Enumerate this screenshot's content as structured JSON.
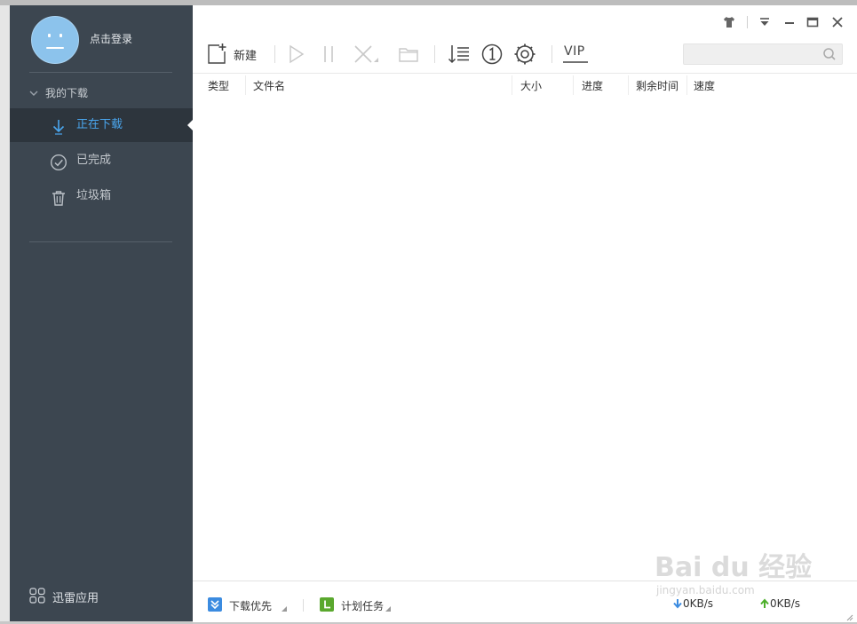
{
  "sidebar": {
    "login_label": "点击登录",
    "group_label": "我的下载",
    "items": [
      {
        "label": "正在下载",
        "icon": "download-arrow-icon",
        "active": true
      },
      {
        "label": "已完成",
        "icon": "check-circle-icon",
        "active": false
      },
      {
        "label": "垃圾箱",
        "icon": "trash-icon",
        "active": false
      }
    ],
    "apps_label": "迅雷应用"
  },
  "toolbar": {
    "new_label": "新建",
    "vip_label": "VIP",
    "search_placeholder": ""
  },
  "table": {
    "columns": [
      "类型",
      "文件名",
      "大小",
      "进度",
      "剩余时间",
      "速度"
    ]
  },
  "statusbar": {
    "priority_label": "下载优先",
    "schedule_label": "计划任务",
    "down_speed": "0KB/s",
    "up_speed": "0KB/s"
  },
  "watermark": {
    "text": "Bai du 经验",
    "sub": "jingyan.baidu.com"
  },
  "colors": {
    "sidebar_bg": "#3c4650",
    "active_bg": "#2d353d",
    "accent": "#4aa6ee",
    "down_arrow": "#3b8be0",
    "up_arrow": "#4caf2a",
    "priority_icon": "#3b8be0",
    "schedule_icon": "#5aa82e"
  }
}
